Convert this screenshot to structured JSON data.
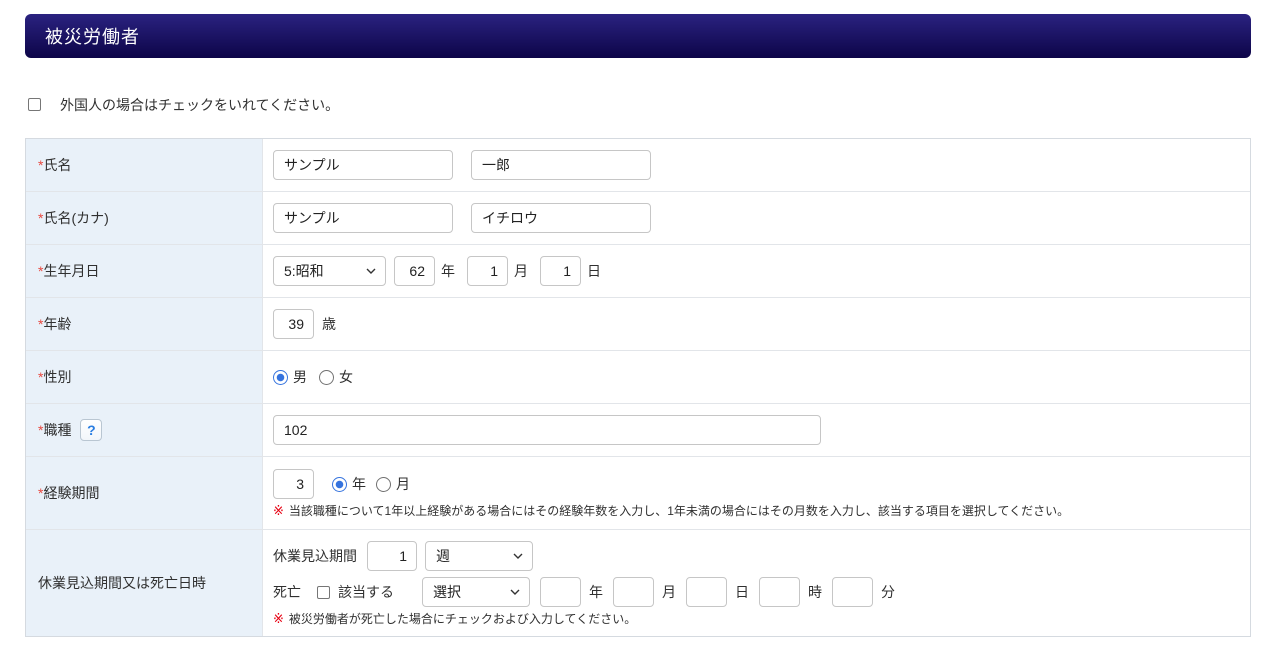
{
  "colors": {
    "header_top": "#2a2280",
    "header_bottom": "#0d0548",
    "label_bg": "#e9f1f9",
    "required": "#e8483f",
    "note_mark": "#e60012",
    "accent_blue": "#3573de",
    "help_blue": "#2a7de1"
  },
  "header": {
    "title": "被災労働者"
  },
  "required_mark": "*",
  "note_mark": "※",
  "foreigner": {
    "label": "外国人の場合はチェックをいれてください。",
    "checked": false
  },
  "rows": {
    "name": {
      "label": "氏名",
      "last_value": "サンプル",
      "first_value": "一郎"
    },
    "kana": {
      "label": "氏名(カナ)",
      "last_value": "サンプル",
      "first_value": "イチロウ"
    },
    "birth": {
      "label": "生年月日",
      "era_selected": "5:昭和",
      "year_value": "62",
      "year_unit": "年",
      "month_value": "1",
      "month_unit": "月",
      "day_value": "1",
      "day_unit": "日"
    },
    "age": {
      "label": "年齢",
      "value": "39",
      "unit": "歳"
    },
    "gender": {
      "label": "性別",
      "male_label": "男",
      "female_label": "女",
      "selected": "男",
      "male_checked": "checked"
    },
    "occupation": {
      "label": "職種",
      "help_label": "?",
      "value": "102"
    },
    "experience": {
      "label": "経験期間",
      "value": "3",
      "unit_year_label": "年",
      "unit_month_label": "月",
      "selected_unit": "年",
      "year_checked": "checked",
      "note": "当該職種について1年以上経験がある場合にはその経験年数を入力し、1年未満の場合にはその月数を入力し、該当する項目を選択してください。"
    },
    "leave_or_death": {
      "label": "休業見込期間又は死亡日時",
      "leave_label": "休業見込期間",
      "leave_value": "1",
      "leave_unit_selected": "週",
      "death_label": "死亡",
      "death_check_label": "該当する",
      "death_checked": false,
      "death_era_selected": "選択",
      "death_year_value": "",
      "year_unit": "年",
      "death_month_value": "",
      "month_unit": "月",
      "death_day_value": "",
      "day_unit": "日",
      "death_hour_value": "",
      "hour_unit": "時",
      "death_minute_value": "",
      "minute_unit": "分",
      "note": "被災労働者が死亡した場合にチェックおよび入力してください。"
    }
  }
}
